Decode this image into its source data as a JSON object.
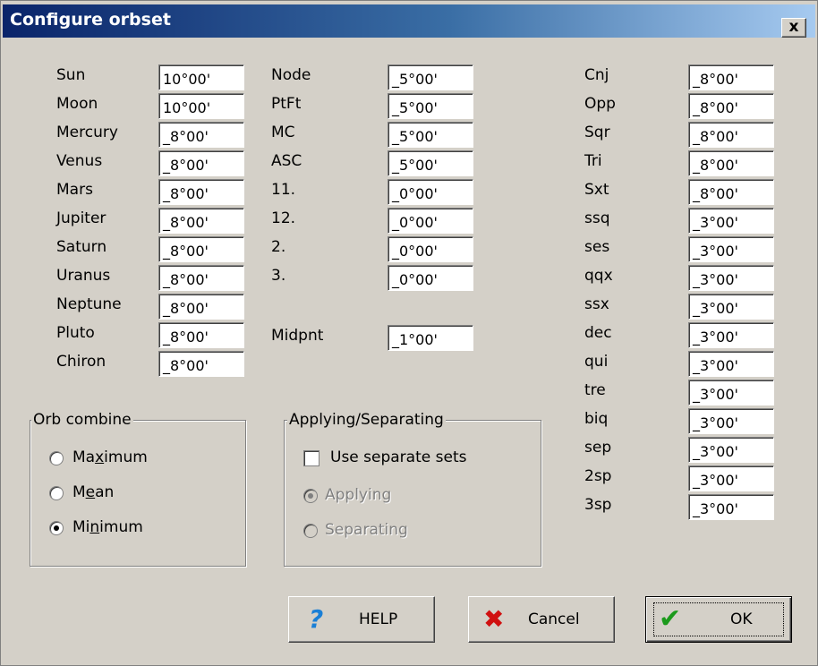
{
  "window": {
    "title": "Configure orbset",
    "close_glyph": "x"
  },
  "planets": [
    {
      "label": "Sun",
      "value": "10°00'"
    },
    {
      "label": "Moon",
      "value": "10°00'"
    },
    {
      "label": "Mercury",
      "value": "_8°00'"
    },
    {
      "label": "Venus",
      "value": "_8°00'"
    },
    {
      "label": "Mars",
      "value": "_8°00'"
    },
    {
      "label": "Jupiter",
      "value": "_8°00'"
    },
    {
      "label": "Saturn",
      "value": "_8°00'"
    },
    {
      "label": "Uranus",
      "value": "_8°00'"
    },
    {
      "label": "Neptune",
      "value": "_8°00'"
    },
    {
      "label": "Pluto",
      "value": "_8°00'"
    },
    {
      "label": "Chiron",
      "value": "_8°00'"
    }
  ],
  "points": [
    {
      "label": "Node",
      "value": "_5°00'"
    },
    {
      "label": "PtFt",
      "value": "_5°00'"
    },
    {
      "label": "MC",
      "value": "_5°00'"
    },
    {
      "label": "ASC",
      "value": "_5°00'"
    },
    {
      "label": "11.",
      "value": "_0°00'"
    },
    {
      "label": "12.",
      "value": "_0°00'"
    },
    {
      "label": "2.",
      "value": "_0°00'"
    },
    {
      "label": "3.",
      "value": "_0°00'"
    }
  ],
  "midpoint": {
    "label": "Midpnt",
    "value": "_1°00'"
  },
  "aspects": [
    {
      "label": "Cnj",
      "value": "_8°00'"
    },
    {
      "label": "Opp",
      "value": "_8°00'"
    },
    {
      "label": "Sqr",
      "value": "_8°00'"
    },
    {
      "label": "Tri",
      "value": "_8°00'"
    },
    {
      "label": "Sxt",
      "value": "_8°00'"
    },
    {
      "label": "ssq",
      "value": "_3°00'"
    },
    {
      "label": "ses",
      "value": "_3°00'"
    },
    {
      "label": "qqx",
      "value": "_3°00'"
    },
    {
      "label": "ssx",
      "value": "_3°00'"
    },
    {
      "label": "dec",
      "value": "_3°00'"
    },
    {
      "label": "qui",
      "value": "_3°00'"
    },
    {
      "label": "tre",
      "value": "_3°00'"
    },
    {
      "label": "biq",
      "value": "_3°00'"
    },
    {
      "label": "sep",
      "value": "_3°00'"
    },
    {
      "label": "2sp",
      "value": "_3°00'"
    },
    {
      "label": "3sp",
      "value": "_3°00'"
    }
  ],
  "orb_combine": {
    "title": "Orb combine",
    "options": [
      {
        "pre": "Ma",
        "key": "x",
        "post": "imum",
        "selected": false
      },
      {
        "pre": "M",
        "key": "e",
        "post": "an",
        "selected": false
      },
      {
        "pre": "Mi",
        "key": "n",
        "post": "imum",
        "selected": true
      }
    ]
  },
  "applying": {
    "title": "Applying/Separating",
    "checkbox_label": "Use separate sets",
    "checked": false,
    "options": [
      {
        "label": "Applying",
        "selected": true,
        "disabled": true
      },
      {
        "label": "Separating",
        "selected": false,
        "disabled": true
      }
    ]
  },
  "buttons": {
    "help": {
      "label": "HELP",
      "icon": "question-mark-icon"
    },
    "cancel": {
      "label": "Cancel",
      "icon": "red-x-icon"
    },
    "ok": {
      "label": "OK",
      "icon": "green-check-icon"
    }
  },
  "colors": {
    "title_start": "#0a246a",
    "title_end": "#a6caf0",
    "face": "#d4d0c8",
    "help_icon": "#1a7fd6",
    "cancel_icon": "#d01010",
    "ok_icon": "#1c9a1c"
  }
}
